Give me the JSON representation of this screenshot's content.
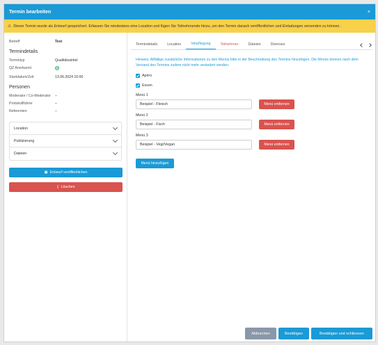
{
  "modal": {
    "title": "Termin bearbeiten",
    "close": "×"
  },
  "warning": {
    "icon": "⚠",
    "text": "Dieser Termin wurde als Entwurf gespeichert. Erfassen Sie mindestens eine Location und fügen Sie Teilnehmende hinzu, um den Termin danach veröffentlichen und Einladungen versenden zu können."
  },
  "left": {
    "betreff": {
      "label": "Betreff",
      "value": "Test"
    },
    "details_title": "Termindetails",
    "details": [
      {
        "label": "Termintyp",
        "value": "Qualitätszirkel"
      },
      {
        "label": "QZ Anerkannt",
        "value": ""
      },
      {
        "label": "Startdatum/Zeit",
        "value": "13.06.2024 10:00"
      }
    ],
    "persons_title": "Personen",
    "persons": [
      {
        "label": "Moderator / Co-Moderator",
        "value": "–"
      },
      {
        "label": "Protokollführer",
        "value": "–"
      },
      {
        "label": "Referenten",
        "value": "–"
      }
    ],
    "accordion": [
      "Location",
      "Publizierung",
      "Dateien"
    ],
    "publish_label": "Entwurf veröffentlichen",
    "delete_label": "Löschen"
  },
  "tabs": [
    "Termindetails",
    "Location",
    "Verpflegung",
    "Teilnehmer",
    "Dateien",
    "Diverses"
  ],
  "content": {
    "hint": "Hinweis: Allfällige zusätzliche Informationen zu den Menüs bitte in der Beschreibung des Termins hinzufügen. Die Menüs können nach dem Versand des Termins zudem nicht mehr verändert werden.",
    "apero": "Apéro",
    "essen": "Essen",
    "menus": [
      {
        "label": "Menü 1",
        "value": "Beispiel - Fleisch"
      },
      {
        "label": "Menü 2",
        "value": "Beispiel - Fisch"
      },
      {
        "label": "Menü 3",
        "value": "Beispiel - Vegi/Vegan"
      }
    ],
    "remove_label": "Menü entfernen",
    "add_label": "Menü hinzufügen"
  },
  "footer": {
    "cancel": "Abbrechen",
    "confirm": "Bestätigen",
    "confirm_close": "Bestätigen und schliessen"
  },
  "colors": {
    "primary": "#1a9ad6",
    "danger": "#d9534f",
    "warning": "#f7d14a",
    "muted": "#8a97a8"
  }
}
